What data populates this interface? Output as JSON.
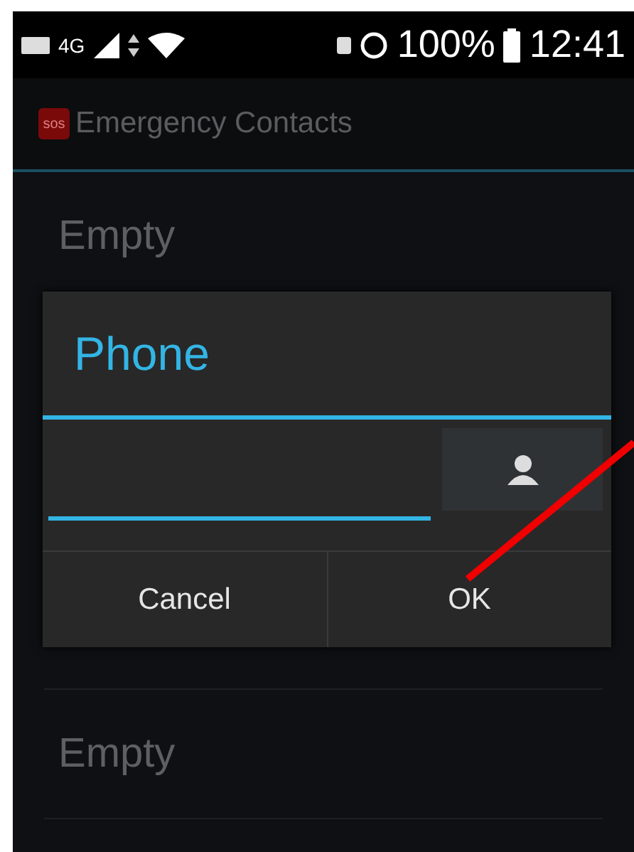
{
  "status_bar": {
    "network": "4G",
    "battery": "100%",
    "time": "12:41"
  },
  "app_bar": {
    "icon_text": "sos",
    "title": "Emergency Contacts"
  },
  "contacts": [
    {
      "label": "Empty"
    },
    {
      "label": "Empty"
    }
  ],
  "dialog": {
    "title": "Phone",
    "field": {
      "focused": true
    },
    "buttons": [
      {
        "label": "Cancel"
      },
      {
        "label": "OK"
      }
    ]
  }
}
